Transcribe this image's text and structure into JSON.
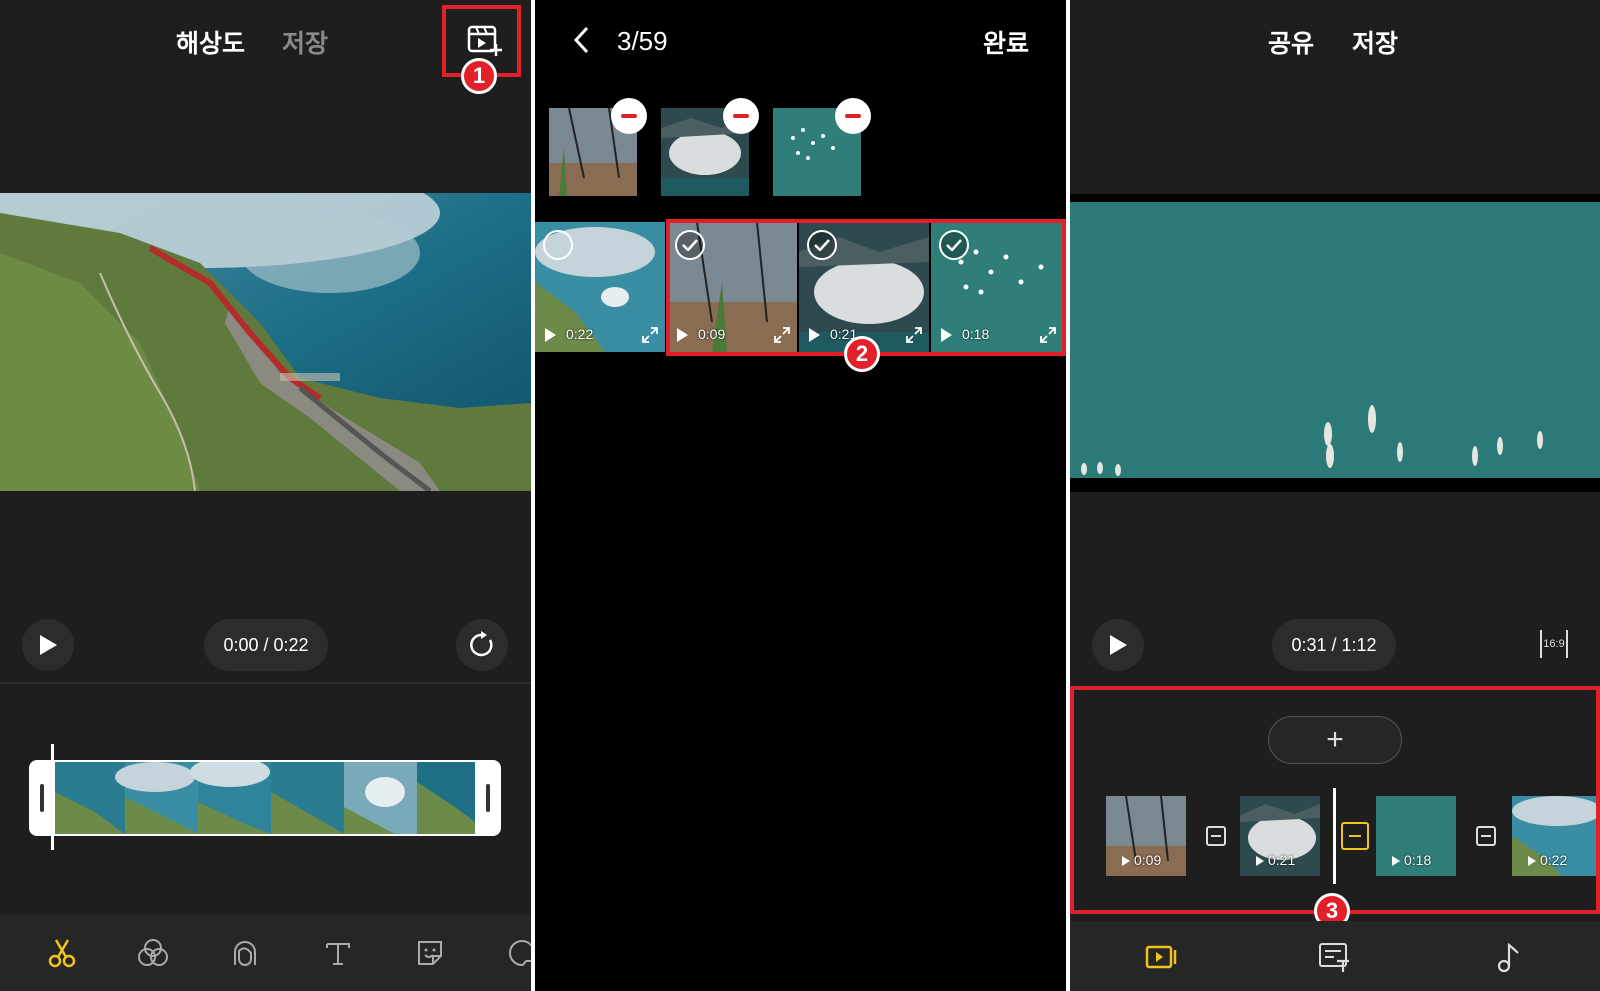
{
  "panel1": {
    "header": {
      "resolution_label": "해상도",
      "save_label": "저장"
    },
    "badge1": "1",
    "time_display": "0:00 / 0:22"
  },
  "panel2": {
    "header": {
      "count": "3/59",
      "done_label": "완료"
    },
    "grid": [
      {
        "duration": "0:22",
        "checked": false
      },
      {
        "duration": "0:09",
        "checked": true
      },
      {
        "duration": "0:21",
        "checked": true
      },
      {
        "duration": "0:18",
        "checked": true
      }
    ],
    "badge2": "2"
  },
  "panel3": {
    "header": {
      "share_label": "공유",
      "save_label": "저장"
    },
    "time_display": "0:31 / 1:12",
    "aspect_label": "16:9",
    "add_label": "+",
    "timeline": [
      {
        "duration": "0:09"
      },
      {
        "duration": "0:21"
      },
      {
        "duration": "0:18"
      },
      {
        "duration": "0:22"
      }
    ],
    "badge3": "3"
  },
  "colors": {
    "accent": "#f0c419",
    "highlight_red": "#e3202a",
    "panel_bg": "#1e1e1e"
  }
}
